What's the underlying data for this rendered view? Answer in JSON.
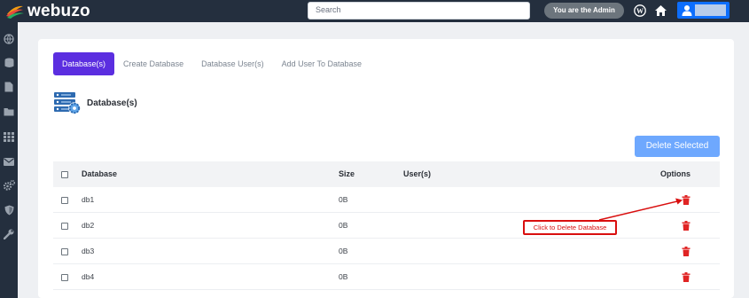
{
  "app": {
    "logo_text": "webuzo"
  },
  "topbar": {
    "search_placeholder": "Search",
    "admin_badge": "You are the Admin",
    "icons": [
      "wordpress-icon",
      "home-icon",
      "user-icon"
    ]
  },
  "sidebar": {
    "icons": [
      "globe-icon",
      "database-icon",
      "file-icon",
      "folder-icon",
      "apps-grid-icon",
      "mail-icon",
      "gears-icon",
      "shield-icon",
      "wrench-icon"
    ]
  },
  "tabs": [
    {
      "label": "Database(s)",
      "active": true
    },
    {
      "label": "Create Database",
      "active": false
    },
    {
      "label": "Database User(s)",
      "active": false
    },
    {
      "label": "Add User To Database",
      "active": false
    }
  ],
  "section": {
    "title": "Database(s)"
  },
  "actions": {
    "delete_selected": "Delete Selected"
  },
  "table": {
    "columns": {
      "database": "Database",
      "size": "Size",
      "users": "User(s)",
      "options": "Options"
    },
    "rows": [
      {
        "database": "db1",
        "size": "0B",
        "users": ""
      },
      {
        "database": "db2",
        "size": "0B",
        "users": ""
      },
      {
        "database": "db3",
        "size": "0B",
        "users": ""
      },
      {
        "database": "db4",
        "size": "0B",
        "users": ""
      }
    ]
  },
  "annotation": {
    "text": "Click to Delete Database"
  },
  "colors": {
    "topbar": "#242f3e",
    "tab_active": "#5b2ee0",
    "primary": "#0d6efd",
    "delete_button": "#6ea8fe",
    "trash": "#e02424",
    "annotation": "#d90f0f"
  }
}
